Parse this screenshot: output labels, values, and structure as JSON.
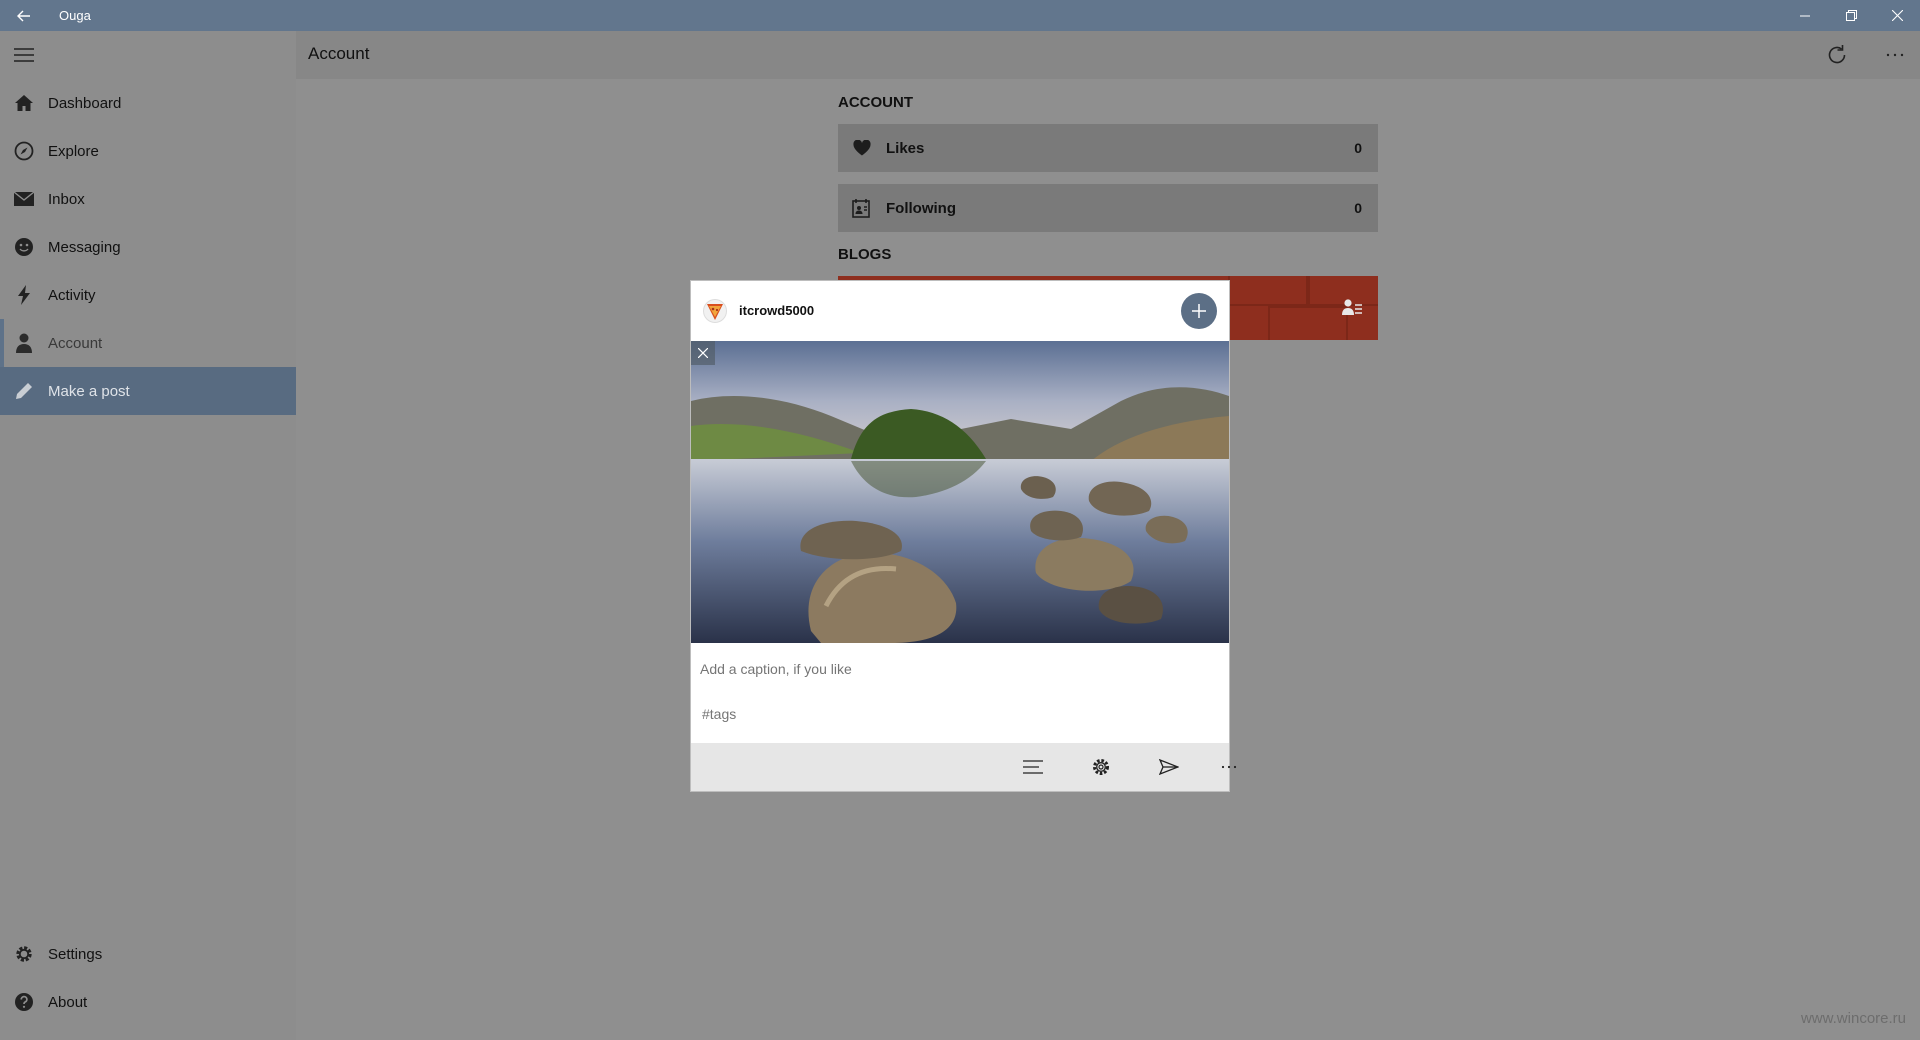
{
  "window": {
    "title": "Ouga"
  },
  "sidebar": {
    "items": [
      {
        "label": "Dashboard",
        "icon": "home-icon"
      },
      {
        "label": "Explore",
        "icon": "compass-icon"
      },
      {
        "label": "Inbox",
        "icon": "mail-icon"
      },
      {
        "label": "Messaging",
        "icon": "smiley-icon"
      },
      {
        "label": "Activity",
        "icon": "lightning-icon"
      },
      {
        "label": "Account",
        "icon": "person-icon",
        "state": "selected"
      },
      {
        "label": "Make a post",
        "icon": "pencil-icon",
        "state": "active"
      }
    ],
    "footer": [
      {
        "label": "Settings",
        "icon": "gear-icon"
      },
      {
        "label": "About",
        "icon": "help-icon"
      }
    ]
  },
  "header": {
    "title": "Account"
  },
  "account": {
    "heading": "ACCOUNT",
    "likes": {
      "label": "Likes",
      "value": "0"
    },
    "following": {
      "label": "Following",
      "value": "0"
    }
  },
  "blogs": {
    "heading": "BLOGS"
  },
  "post_dialog": {
    "username": "itcrowd5000",
    "caption_placeholder": "Add a caption, if you like",
    "tags_placeholder": "#tags"
  },
  "watermark": "www.wincore.ru",
  "colors": {
    "titlebar": "#62768d",
    "accent": "#586b81",
    "blog_banner": "#8e2e1e",
    "overlay": "#8f8f8f"
  }
}
